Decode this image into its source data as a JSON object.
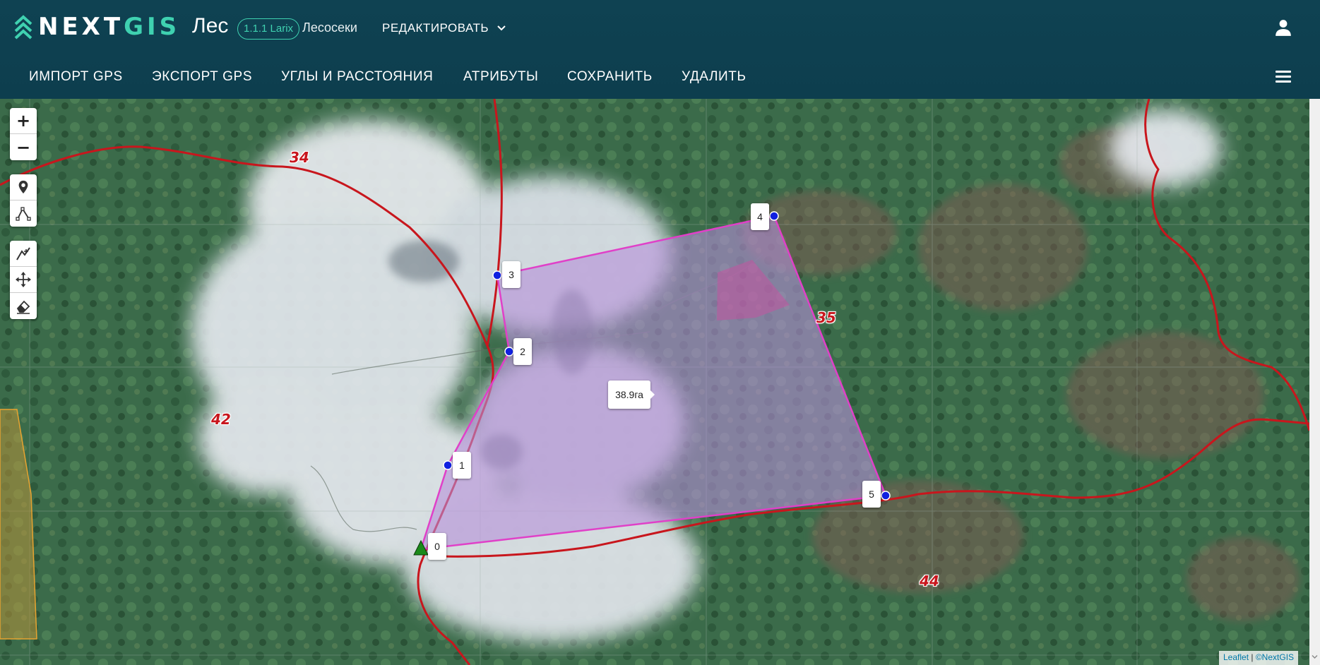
{
  "header": {
    "logo_text_a": "NEXT",
    "logo_text_b": "GIS",
    "app_name": "Лес",
    "version": "1.1.1 Larix",
    "page_name": "Лесосеки",
    "edit_menu_label": "РЕДАКТИРОВАТЬ",
    "icons": [
      "logo-mark-icon",
      "chevron-down-icon",
      "account-icon",
      "menu-icon"
    ]
  },
  "toolbar": {
    "buttons": [
      {
        "label": "ИМПОРТ GPS"
      },
      {
        "label": "ЭКСПОРТ GPS"
      },
      {
        "label": "УГЛЫ И РАССТОЯНИЯ"
      },
      {
        "label": "АТРИБУТЫ"
      },
      {
        "label": "СОХРАНИТЬ"
      },
      {
        "label": "УДАЛИТЬ"
      }
    ]
  },
  "map_controls": {
    "zoom_in": "+",
    "zoom_out": "−",
    "tools": [
      "marker-icon",
      "polyline-icon",
      "draw-cut-icon",
      "move-icon",
      "eraser-icon"
    ]
  },
  "map": {
    "area_label": "38.9га",
    "vertices": [
      "0",
      "1",
      "2",
      "3",
      "4",
      "5"
    ],
    "block_numbers": [
      "34",
      "35",
      "42",
      "44"
    ],
    "colors": {
      "polygon_fill": "#b690d8",
      "polygon_stroke": "#e040c8",
      "boundary_line": "#c8161d",
      "vertex_marker": "#1020e0",
      "start_marker": "#1a8a1a"
    }
  },
  "attribution": {
    "leaflet": "Leaflet",
    "separator": "|",
    "nextgis": "©NextGIS"
  }
}
